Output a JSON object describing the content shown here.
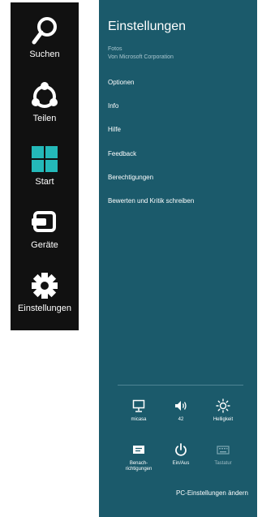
{
  "charms": {
    "search_label": "Suchen",
    "share_label": "Teilen",
    "start_label": "Start",
    "devices_label": "Geräte",
    "settings_label": "Einstellungen"
  },
  "pane": {
    "title": "Einstellungen",
    "app_name": "Fotos",
    "publisher": "Von Microsoft Corporation",
    "menu": [
      "Optionen",
      "Info",
      "Hilfe",
      "Feedback",
      "Berechtigungen",
      "Bewerten und Kritik schreiben"
    ],
    "tiles": {
      "network": "micasa",
      "volume": "42",
      "brightness": "Helligkeit",
      "notifications": "Benach-\nrichtigungen",
      "power": "Ein/Aus",
      "keyboard": "Tastatur"
    },
    "pc_settings_link": "PC-Einstellungen ändern"
  },
  "colors": {
    "charms_bg": "#111111",
    "pane_bg": "#1b5a6b",
    "start_logo": "#24b9b9"
  }
}
